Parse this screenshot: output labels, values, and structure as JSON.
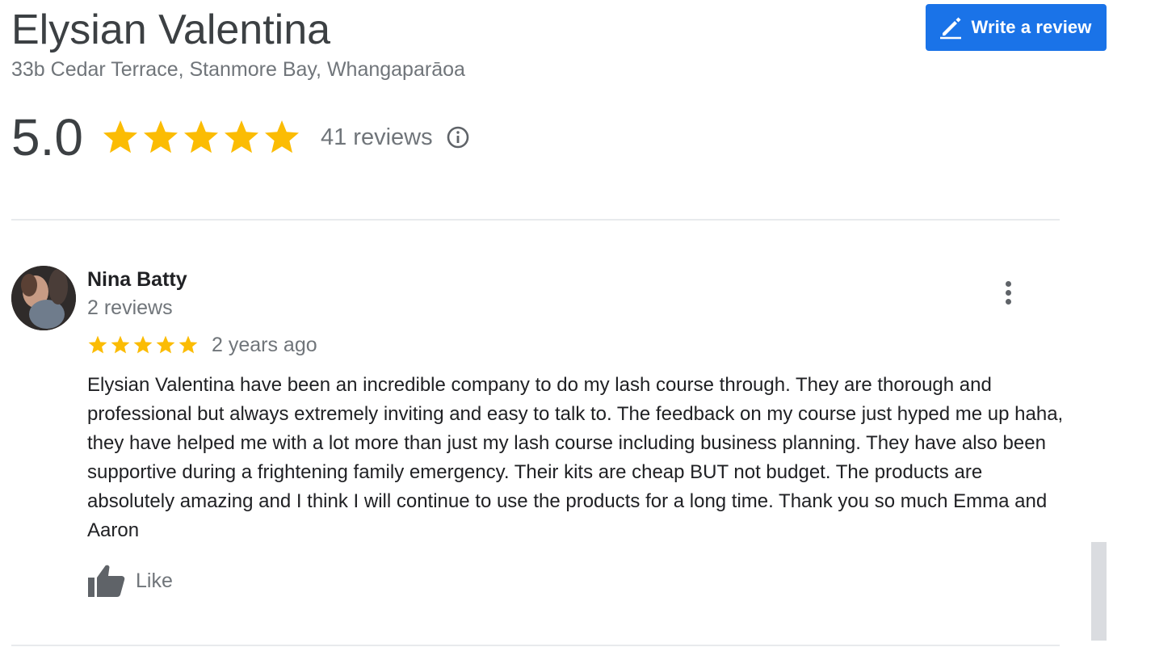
{
  "business": {
    "name": "Elysian Valentina",
    "address": "33b Cedar Terrace, Stanmore Bay, Whangaparāoa"
  },
  "actions": {
    "write_review_label": "Write a review"
  },
  "rating": {
    "value": "5.0",
    "stars": 5,
    "reviews_label": "41 reviews"
  },
  "review": {
    "author": "Nina Batty",
    "author_reviews": "2 reviews",
    "stars": 5,
    "date": "2 years ago",
    "text": "Elysian Valentina have been an incredible company to do my lash course through. They are thorough and professional but always extremely inviting and easy to talk to. The feedback on my course just hyped me up haha, they have helped me with a lot more than just my lash course including business planning. They have also been supportive during a frightening family emergency. Their kits are cheap BUT not budget. The products are absolutely amazing and I think I will continue to use the products for a long time. Thank you so much Emma and Aaron",
    "like_label": "Like"
  },
  "icons": {
    "write": "pencil-icon",
    "info": "info-icon",
    "more": "more-vert-icon",
    "like": "thumbs-up-icon",
    "star": "star-icon"
  },
  "colors": {
    "accent": "#1a73e8",
    "star": "#fbbc04",
    "text_primary": "#202124",
    "text_secondary": "#70757a"
  }
}
